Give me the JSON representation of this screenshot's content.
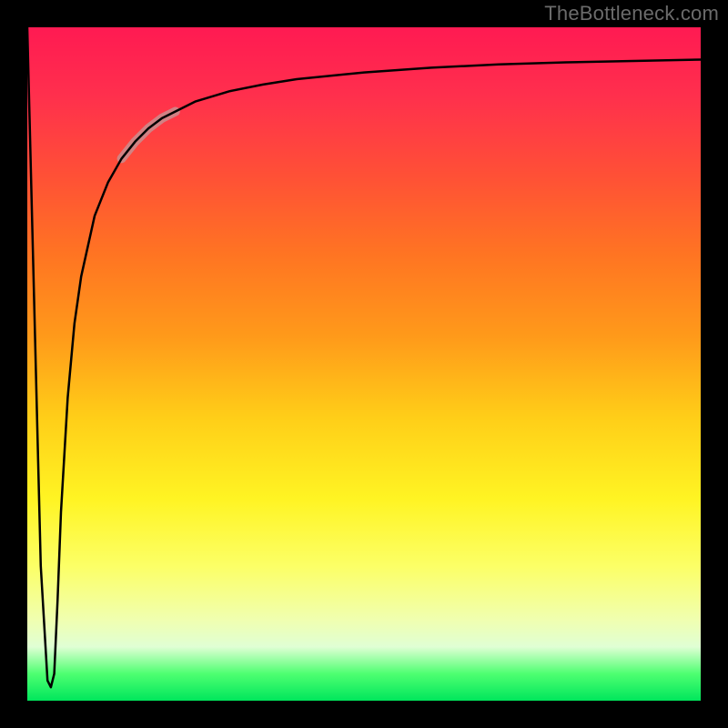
{
  "watermark": "TheBottleneck.com",
  "chart_data": {
    "type": "line",
    "title": "",
    "xlabel": "",
    "ylabel": "",
    "xlim": [
      0,
      100
    ],
    "ylim": [
      0,
      100
    ],
    "grid": false,
    "legend": false,
    "background_gradient": {
      "orientation": "vertical",
      "stops": [
        {
          "pos": 0,
          "color": "#ff1a52"
        },
        {
          "pos": 22,
          "color": "#ff5036"
        },
        {
          "pos": 46,
          "color": "#ff9a1a"
        },
        {
          "pos": 70,
          "color": "#fff423"
        },
        {
          "pos": 88,
          "color": "#f0ffb0"
        },
        {
          "pos": 96,
          "color": "#4eff71"
        },
        {
          "pos": 100,
          "color": "#00e65c"
        }
      ]
    },
    "series": [
      {
        "name": "bottleneck-curve",
        "stroke": "#000000",
        "stroke_width": 2.5,
        "x": [
          0,
          1,
          2,
          3,
          3.5,
          4,
          4.5,
          5,
          6,
          7,
          8,
          10,
          12,
          14,
          16,
          18,
          20,
          25,
          30,
          35,
          40,
          50,
          60,
          70,
          80,
          90,
          100
        ],
        "y": [
          100,
          60,
          20,
          3,
          2,
          4,
          15,
          28,
          45,
          56,
          63,
          72,
          77,
          80.5,
          83,
          85,
          86.5,
          89,
          90.5,
          91.5,
          92.3,
          93.3,
          94,
          94.5,
          94.8,
          95,
          95.2
        ]
      },
      {
        "name": "highlight-segment",
        "stroke": "#c98e8f",
        "stroke_width": 10,
        "opacity": 0.85,
        "x": [
          14,
          16,
          18,
          20,
          22
        ],
        "y": [
          80.5,
          83,
          85,
          86.5,
          87.5
        ]
      }
    ]
  }
}
